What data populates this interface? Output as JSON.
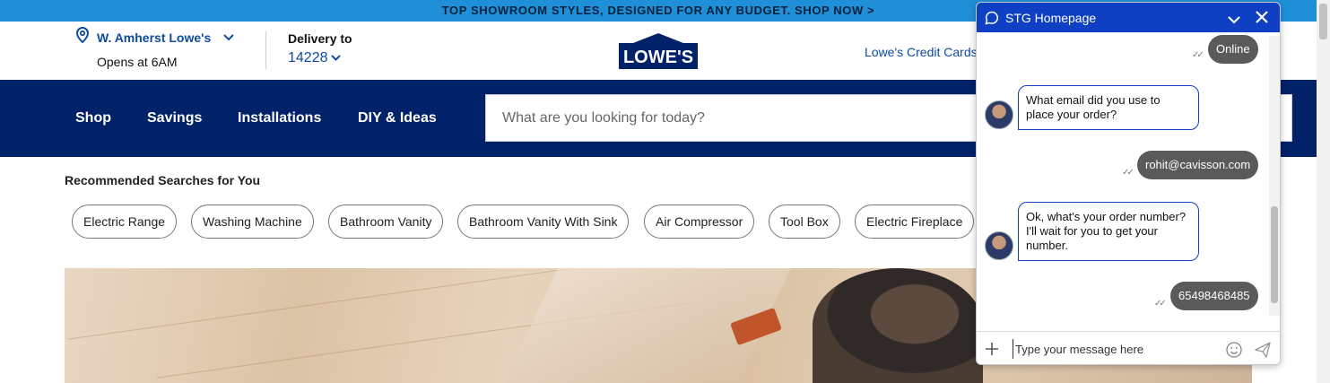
{
  "promo": {
    "text": "TOP SHOWROOM STYLES, DESIGNED FOR ANY BUDGET. SHOP NOW >"
  },
  "header": {
    "store_name": "W. Amherst Lowe's",
    "store_hours": "Opens at 6AM",
    "delivery_label": "Delivery to",
    "delivery_zip": "14228",
    "logo_text": "LOWE'S",
    "credit_link": "Lowe's Credit Cards"
  },
  "nav": {
    "items": [
      {
        "label": "Shop"
      },
      {
        "label": "Savings"
      },
      {
        "label": "Installations"
      },
      {
        "label": "DIY & Ideas"
      }
    ],
    "search_placeholder": "What are you looking for today?"
  },
  "recommended": {
    "title": "Recommended Searches for You",
    "chips": [
      {
        "label": "Electric Range"
      },
      {
        "label": "Washing Machine"
      },
      {
        "label": "Bathroom Vanity"
      },
      {
        "label": "Bathroom Vanity With Sink"
      },
      {
        "label": "Air Compressor"
      },
      {
        "label": "Tool Box"
      },
      {
        "label": "Electric Fireplace"
      }
    ]
  },
  "chat": {
    "title": "STG Homepage",
    "messages": [
      {
        "from": "user",
        "text": "Online"
      },
      {
        "from": "agent",
        "text": "What email did you use to place your order?"
      },
      {
        "from": "user",
        "text": "rohit@cavisson.com"
      },
      {
        "from": "agent",
        "text": "Ok, what's your order number? I'll wait for you to get your number."
      },
      {
        "from": "user",
        "text": "65498468485"
      }
    ],
    "input_placeholder": "Type your message here"
  },
  "colors": {
    "promo_bg": "#1f8fd8",
    "nav_bg": "#012169",
    "brand_blue": "#0f4ba0",
    "chat_header": "#0f3fc2",
    "user_bubble": "#5a5a5a"
  },
  "icons": [
    "location-pin-icon",
    "chevron-down-icon",
    "chat-bubble-icon",
    "minimize-icon",
    "close-icon",
    "plus-icon",
    "emoji-icon",
    "send-icon",
    "read-receipt-icon"
  ]
}
